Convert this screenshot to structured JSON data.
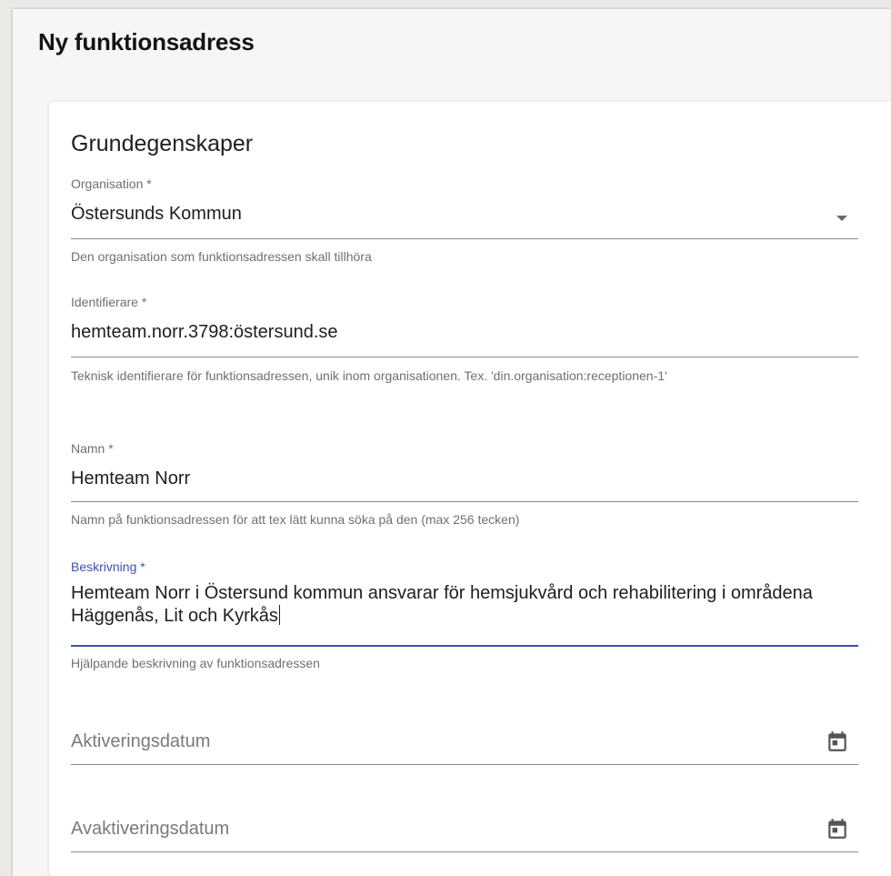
{
  "page": {
    "title": "Ny funktionsadress"
  },
  "card": {
    "section_title": "Grundegenskaper"
  },
  "fields": {
    "organisation": {
      "label": "Organisation *",
      "value": "Östersunds Kommun",
      "hint": "Den organisation som funktionsadressen skall tillhöra",
      "icon": "chevron-down-icon"
    },
    "identifierare": {
      "label": "Identifierare *",
      "value": "hemteam.norr.3798:östersund.se",
      "hint": "Teknisk identifierare för funktionsadressen, unik inom organisationen. Tex. 'din.organisation:receptionen-1'"
    },
    "namn": {
      "label": "Namn *",
      "value": "Hemteam Norr",
      "hint": "Namn på funktionsadressen för att tex lätt kunna söka på den (max 256 tecken)"
    },
    "beskrivning": {
      "label": "Beskrivning *",
      "value": "Hemteam Norr i Östersund kommun ansvarar för hemsjukvård och rehabilitering i områdena Häggenås, Lit och Kyrkås",
      "hint": "Hjälpande beskrivning av funktionsadressen",
      "focused": true
    },
    "aktiveringsdatum": {
      "placeholder": "Aktiveringsdatum",
      "icon": "calendar-icon"
    },
    "avaktiveringsdatum": {
      "placeholder": "Avaktiveringsdatum",
      "icon": "calendar-icon"
    }
  },
  "colors": {
    "accent": "#3f51b5",
    "text": "#1e1e1e",
    "hint": "#707070",
    "background": "#f6f6f6",
    "card": "#ffffff"
  }
}
